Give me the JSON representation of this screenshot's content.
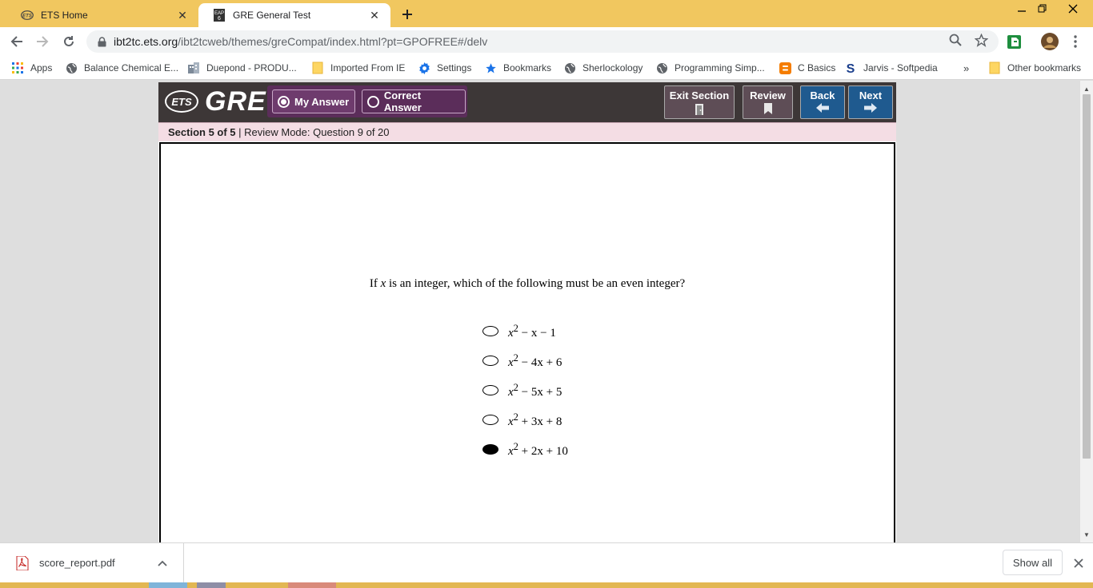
{
  "browser": {
    "tabs": [
      {
        "title": "ETS Home",
        "active": false
      },
      {
        "title": "GRE General Test",
        "active": true
      }
    ],
    "address": {
      "domain": "ibt2tc.ets.org",
      "path": "/ibt2tcweb/themes/greCompat/index.html?pt=GPOFREE#/delv"
    },
    "bookmarks": [
      {
        "label": "Apps",
        "icon": "apps-grid-icon"
      },
      {
        "label": "Balance Chemical E...",
        "icon": "globe-icon"
      },
      {
        "label": "Duepond - PRODU...",
        "icon": "building-icon"
      },
      {
        "label": "Imported From IE",
        "icon": "folder-icon"
      },
      {
        "label": "Settings",
        "icon": "gear-icon"
      },
      {
        "label": "Bookmarks",
        "icon": "star-icon"
      },
      {
        "label": "Sherlockology",
        "icon": "globe-icon"
      },
      {
        "label": "Programming Simp...",
        "icon": "globe-icon"
      },
      {
        "label": "C Basics",
        "icon": "blogger-icon"
      },
      {
        "label": "Jarvis - Softpedia",
        "icon": "softpedia-icon"
      }
    ],
    "overflow_label": "»",
    "other_bookmarks": "Other bookmarks"
  },
  "gre": {
    "logo_text": "ETS",
    "brand": "GRE",
    "my_answer": "My Answer",
    "correct_answer": "Correct Answer",
    "exit_section": "Exit Section",
    "review": "Review",
    "back": "Back",
    "next": "Next",
    "section_label": "Section 5 of 5",
    "mode_label": " | Review Mode: Question 9 of 20"
  },
  "question": {
    "stem_before": "If ",
    "stem_var": "x",
    "stem_after": " is an integer, which of the following must be an even integer?",
    "choices": [
      {
        "base": "x",
        "exp": "2",
        "rest": " − x − 1",
        "selected": false
      },
      {
        "base": "x",
        "exp": "2",
        "rest": " − 4x + 6",
        "selected": false
      },
      {
        "base": "x",
        "exp": "2",
        "rest": " − 5x + 5",
        "selected": false
      },
      {
        "base": "x",
        "exp": "2",
        "rest": " + 3x + 8",
        "selected": false
      },
      {
        "base": "x",
        "exp": "2",
        "rest": " + 2x + 10",
        "selected": true
      }
    ]
  },
  "downloads": {
    "file": "score_report.pdf",
    "show_all": "Show all"
  },
  "colors": {
    "tabstrip": "#f1c75f",
    "gre_header": "#3d3737",
    "answer_toggle": "#5b2d5a",
    "nav_blue": "#1f5a8f",
    "status_pink": "#f4dde4"
  }
}
